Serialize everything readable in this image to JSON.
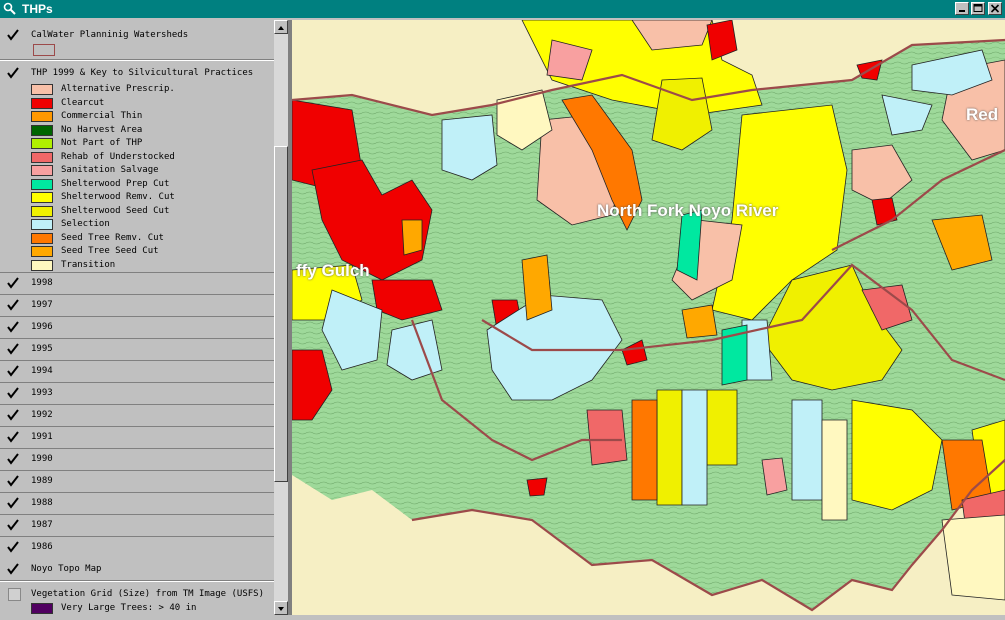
{
  "window": {
    "title": "THPs"
  },
  "legend": {
    "watersheds_theme": "CalWater Planninig Watersheds",
    "thp_theme": "THP 1999 & Key to Silvicultural Practices",
    "classes": [
      {
        "label": "Alternative Prescrip.",
        "color": "#f8c0a8"
      },
      {
        "label": "Clearcut",
        "color": "#f00000"
      },
      {
        "label": "Commercial Thin",
        "color": "#ff9800"
      },
      {
        "label": "No Harvest Area",
        "color": "#006400"
      },
      {
        "label": "Not Part of THP",
        "color": "#b0f000"
      },
      {
        "label": "Rehab of Understocked",
        "color": "#f06868"
      },
      {
        "label": "Sanitation Salvage",
        "color": "#f8a0a0"
      },
      {
        "label": "Shelterwood Prep Cut",
        "color": "#00e8a0"
      },
      {
        "label": "Shelterwood Remv. Cut",
        "color": "#ffff00"
      },
      {
        "label": "Shelterwood Seed Cut",
        "color": "#f0f000"
      },
      {
        "label": "Selection",
        "color": "#c0f0f8"
      },
      {
        "label": "Seed Tree Remv. Cut",
        "color": "#ff7800"
      },
      {
        "label": "Seed Tree Seed Cut",
        "color": "#ffa800"
      },
      {
        "label": "Transition",
        "color": "#fff8c0"
      }
    ],
    "years": [
      "1998",
      "1997",
      "1996",
      "1995",
      "1994",
      "1993",
      "1992",
      "1991",
      "1990",
      "1989",
      "1988",
      "1987",
      "1986"
    ],
    "topo_theme": "Noyo Topo Map",
    "veg_theme": "Vegetation Grid (Size) from TM Image (USFS)",
    "veg_class": {
      "label": "Very Large Trees: > 40 in",
      "color": "#500060"
    }
  },
  "map": {
    "labels": {
      "river": "North Fork Noyo River",
      "gulch": "ffy Gulch",
      "red": "Red"
    }
  },
  "colors": {
    "titlebar": "#008080",
    "topo_green": "#9ed99a",
    "watershed_line": "#9c4a4a",
    "background_beige": "#f6efc4"
  }
}
